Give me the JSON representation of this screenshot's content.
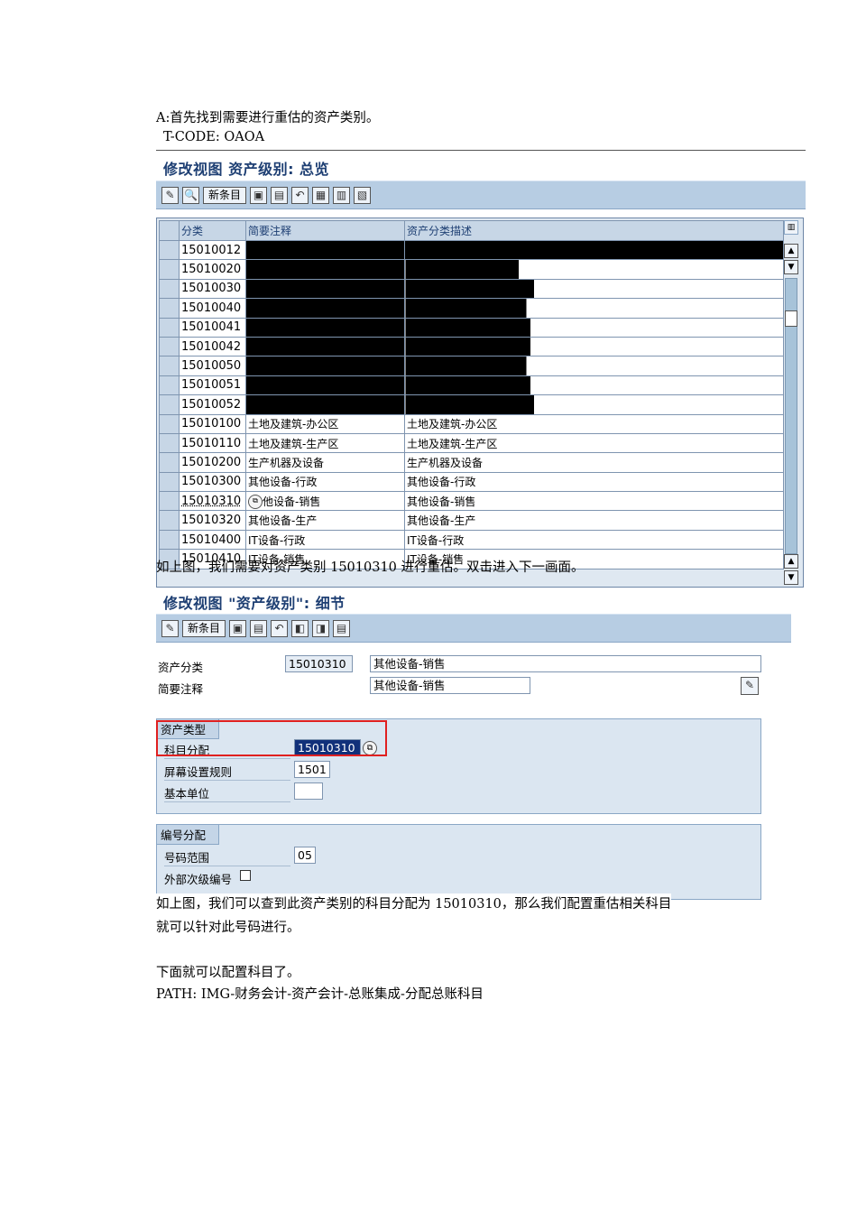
{
  "intro": {
    "line_a": "A:首先找到需要进行重估的资产类别。",
    "tcode": "T-CODE: OAOA"
  },
  "overview": {
    "title": "修改视图 资产级别: 总览",
    "new_entry": "新条目",
    "columns": [
      "分类",
      "简要注释",
      "资产分类描述"
    ],
    "rows": [
      {
        "code": "15010012",
        "short": "",
        "desc": ""
      },
      {
        "code": "15010020",
        "short": "",
        "desc": ""
      },
      {
        "code": "15010030",
        "short": "",
        "desc": ""
      },
      {
        "code": "15010040",
        "short": "",
        "desc": ""
      },
      {
        "code": "15010041",
        "short": "",
        "desc": ""
      },
      {
        "code": "15010042",
        "short": "",
        "desc": ""
      },
      {
        "code": "15010050",
        "short": "",
        "desc": ""
      },
      {
        "code": "15010051",
        "short": "",
        "desc": ""
      },
      {
        "code": "15010052",
        "short": "",
        "desc": ""
      },
      {
        "code": "15010100",
        "short": "土地及建筑-办公区",
        "desc": "土地及建筑-办公区"
      },
      {
        "code": "15010110",
        "short": "土地及建筑-生产区",
        "desc": "土地及建筑-生产区"
      },
      {
        "code": "15010200",
        "short": "生产机器及设备",
        "desc": "生产机器及设备"
      },
      {
        "code": "15010300",
        "short": "其他设备-行政",
        "desc": "其他设备-行政"
      },
      {
        "code": "15010310",
        "short": "他设备-销售",
        "desc": "其他设备-销售"
      },
      {
        "code": "15010320",
        "short": "其他设备-生产",
        "desc": "其他设备-生产"
      },
      {
        "code": "15010400",
        "short": "IT设备-行政",
        "desc": "IT设备-行政"
      },
      {
        "code": "15010410",
        "short": "IT设备-销售",
        "desc": "IT设备-销售"
      }
    ]
  },
  "caption1": "如上图，我们需要对资产类别 15010310 进行重估。双击进入下一画面。",
  "detail": {
    "title": "修改视图 \"资产级别\": 细节",
    "new_entry": "新条目",
    "asset_class_label": "资产分类",
    "asset_class_value": "15010310",
    "asset_class_desc": "其他设备-销售",
    "short_text_label": "简要注释",
    "short_text_value": "其他设备-销售",
    "group1_title": "资产类型",
    "account_det_label": "科目分配",
    "account_det_value": "15010310",
    "screen_layout_label": "屏幕设置规则",
    "screen_layout_value": "1501",
    "base_unit_label": "基本单位",
    "base_unit_value": "",
    "group2_title": "编号分配",
    "number_range_label": "号码范围",
    "number_range_value": "05",
    "ext_sub_label": "外部次级编号"
  },
  "caption2_line1": "如上图，我们可以查到此资产类别的科目分配为 15010310，那么我们配置重估相关科目",
  "caption2_line2": "就可以针对此号码进行。",
  "next_line": "下面就可以配置科目了。",
  "path_line": "PATH: IMG-财务会计-资产会计-总账集成-分配总账科目"
}
